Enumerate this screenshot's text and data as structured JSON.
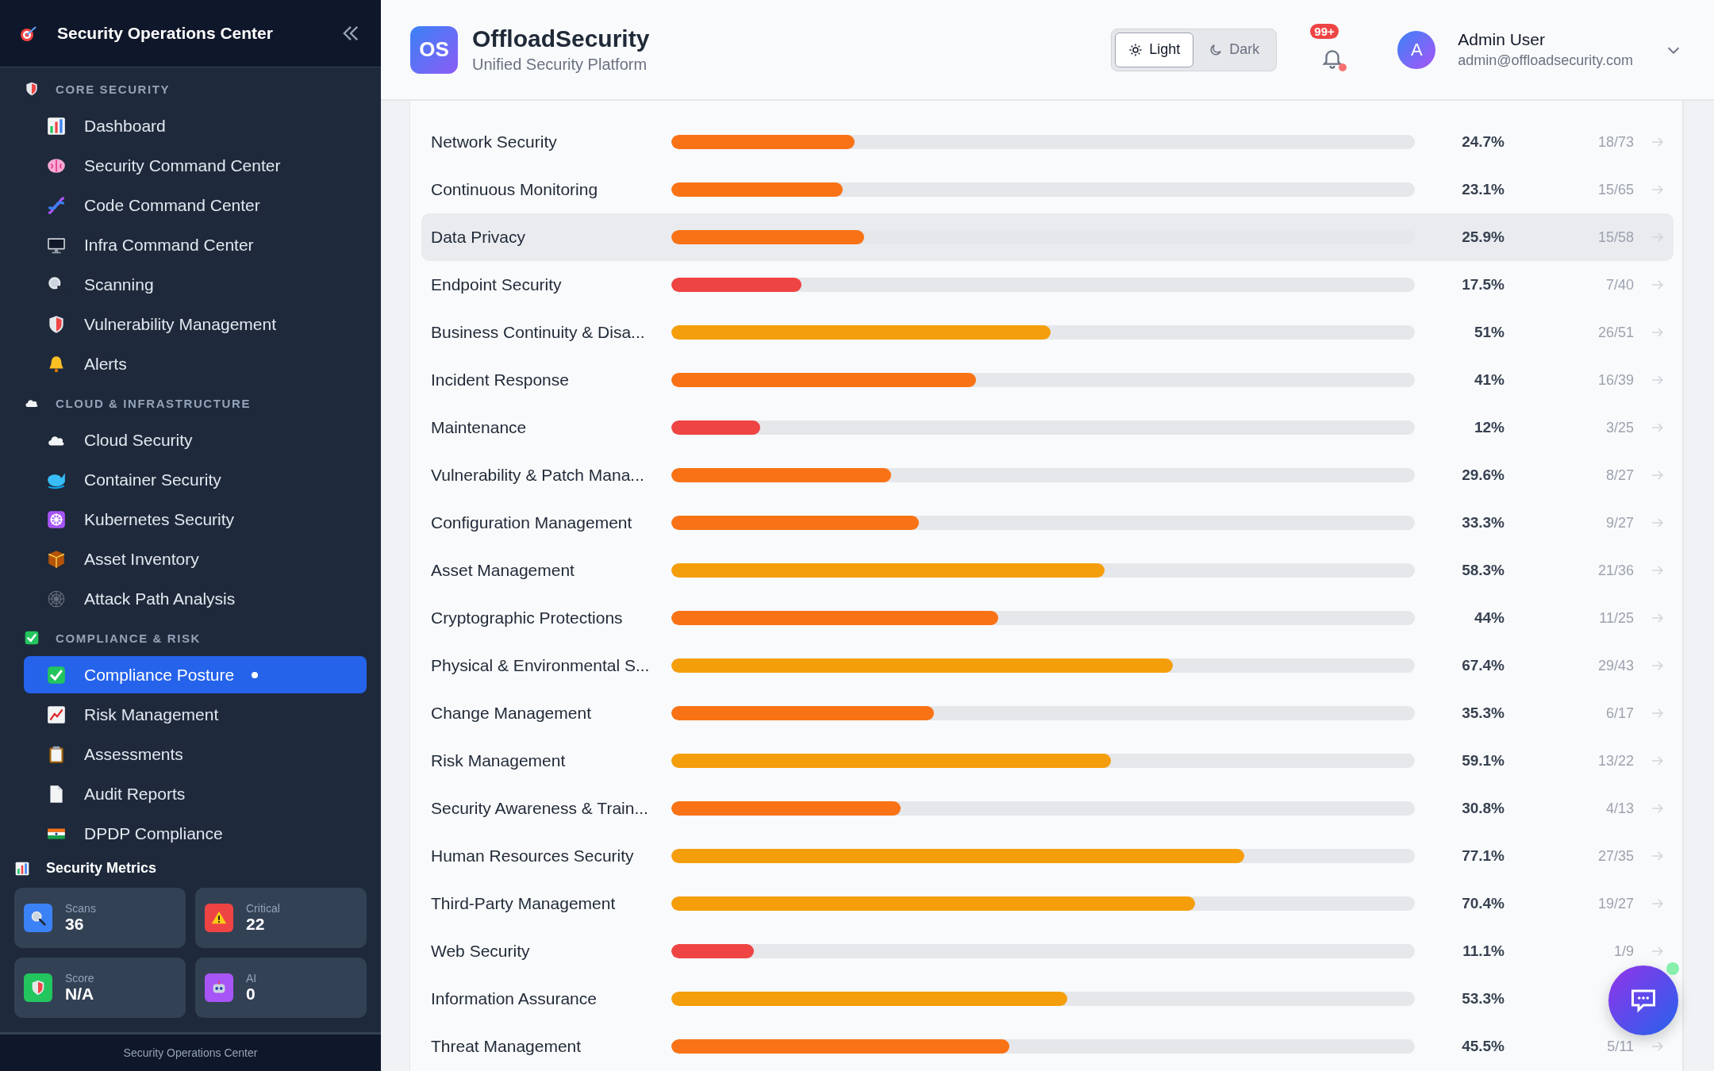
{
  "sidebar": {
    "title": "Security Operations Center",
    "sections": [
      {
        "title": "CORE SECURITY",
        "items": [
          {
            "label": "Dashboard",
            "selected": false
          },
          {
            "label": "Security Command Center",
            "selected": false
          },
          {
            "label": "Code Command Center",
            "selected": false
          },
          {
            "label": "Infra Command Center",
            "selected": false
          },
          {
            "label": "Scanning",
            "selected": false
          },
          {
            "label": "Vulnerability Management",
            "selected": false
          },
          {
            "label": "Alerts",
            "selected": false
          }
        ]
      },
      {
        "title": "CLOUD & INFRASTRUCTURE",
        "items": [
          {
            "label": "Cloud Security",
            "selected": false
          },
          {
            "label": "Container Security",
            "selected": false
          },
          {
            "label": "Kubernetes Security",
            "selected": false
          },
          {
            "label": "Asset Inventory",
            "selected": false
          },
          {
            "label": "Attack Path Analysis",
            "selected": false
          }
        ]
      },
      {
        "title": "COMPLIANCE & RISK",
        "items": [
          {
            "label": "Compliance Posture",
            "selected": true
          },
          {
            "label": "Risk Management",
            "selected": false
          },
          {
            "label": "Assessments",
            "selected": false
          },
          {
            "label": "Audit Reports",
            "selected": false
          },
          {
            "label": "DPDP Compliance",
            "selected": false
          }
        ]
      }
    ],
    "metrics_title": "Security Metrics",
    "metrics": [
      {
        "label": "Scans",
        "value": "36",
        "color": "#3b82f6"
      },
      {
        "label": "Critical",
        "value": "22",
        "color": "#ef4444"
      },
      {
        "label": "Score",
        "value": "N/A",
        "color": "#22c55e"
      },
      {
        "label": "AI",
        "value": "0",
        "color": "#a855f7"
      }
    ],
    "footer": "Security Operations Center"
  },
  "header": {
    "logo": "OS",
    "title": "OffloadSecurity",
    "subtitle": "Unified Security Platform",
    "theme_toggle": [
      {
        "label": "Light",
        "selected": true
      },
      {
        "label": "Dark",
        "selected": false
      }
    ],
    "notifications_badge": "99+",
    "user_initial": "A",
    "user_name": "Admin User",
    "user_email": "admin@offloadsecurity.com"
  },
  "domains": [
    {
      "name": "Network Security",
      "level": 0.247,
      "percent": "24.7%",
      "count": "18/73",
      "selected": false
    },
    {
      "name": "Continuous Monitoring",
      "level": 0.231,
      "percent": "23.1%",
      "count": "15/65",
      "selected": false
    },
    {
      "name": "Data Privacy",
      "level": 0.259,
      "percent": "25.9%",
      "count": "15/58",
      "selected": true
    },
    {
      "name": "Endpoint Security",
      "level": 0.175,
      "percent": "17.5%",
      "count": "7/40",
      "selected": false
    },
    {
      "name": "Business Continuity & Disa...",
      "level": 0.51,
      "percent": "51%",
      "count": "26/51",
      "selected": false
    },
    {
      "name": "Incident Response",
      "level": 0.41,
      "percent": "41%",
      "count": "16/39",
      "selected": false
    },
    {
      "name": "Maintenance",
      "level": 0.12,
      "percent": "12%",
      "count": "3/25",
      "selected": false
    },
    {
      "name": "Vulnerability & Patch Mana...",
      "level": 0.296,
      "percent": "29.6%",
      "count": "8/27",
      "selected": false
    },
    {
      "name": "Configuration Management",
      "level": 0.333,
      "percent": "33.3%",
      "count": "9/27",
      "selected": false
    },
    {
      "name": "Asset Management",
      "level": 0.583,
      "percent": "58.3%",
      "count": "21/36",
      "selected": false
    },
    {
      "name": "Cryptographic Protections",
      "level": 0.44,
      "percent": "44%",
      "count": "11/25",
      "selected": false
    },
    {
      "name": "Physical & Environmental S...",
      "level": 0.674,
      "percent": "67.4%",
      "count": "29/43",
      "selected": false
    },
    {
      "name": "Change Management",
      "level": 0.353,
      "percent": "35.3%",
      "count": "6/17",
      "selected": false
    },
    {
      "name": "Risk Management",
      "level": 0.591,
      "percent": "59.1%",
      "count": "13/22",
      "selected": false
    },
    {
      "name": "Security Awareness & Train...",
      "level": 0.308,
      "percent": "30.8%",
      "count": "4/13",
      "selected": false
    },
    {
      "name": "Human Resources Security",
      "level": 0.771,
      "percent": "77.1%",
      "count": "27/35",
      "selected": false
    },
    {
      "name": "Third-Party Management",
      "level": 0.704,
      "percent": "70.4%",
      "count": "19/27",
      "selected": false
    },
    {
      "name": "Web Security",
      "level": 0.111,
      "percent": "11.1%",
      "count": "1/9",
      "selected": false
    },
    {
      "name": "Information Assurance",
      "level": 0.533,
      "percent": "53.3%",
      "selected": false
    },
    {
      "name": "Threat Management",
      "level": 0.455,
      "percent": "45.5%",
      "count": "5/11",
      "selected": false
    }
  ]
}
